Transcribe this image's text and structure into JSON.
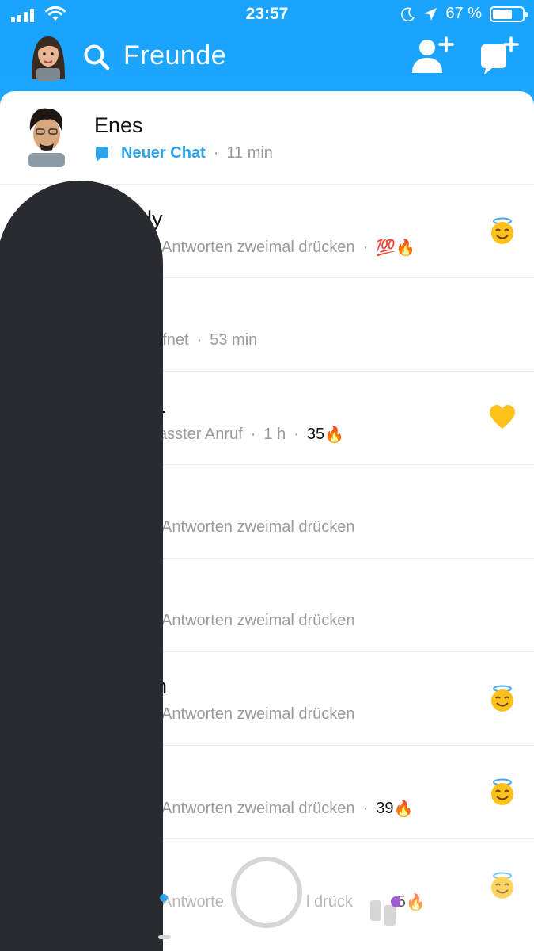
{
  "status_bar": {
    "time": "23:57",
    "battery_percent": "67 %",
    "battery_level": 0.67
  },
  "header": {
    "title": "Freunde"
  },
  "chats": [
    {
      "name": "Enes",
      "status": "Neuer Chat",
      "time": "11 min",
      "status_type": "new"
    },
    {
      "name": "dy",
      "status": "Antworten zweimal drücken",
      "streak_icon": "💯🔥",
      "badge": "halo-smile-emoji"
    },
    {
      "name": "",
      "status": "ffnet",
      "time": "53 min"
    },
    {
      "name": "k.",
      "status": "asster Anruf",
      "time": "1 h",
      "streak": "35",
      "badge": "yellow-heart-emoji"
    },
    {
      "name": "",
      "status": "Antworten zweimal drücken"
    },
    {
      "name": "",
      "status": "Antworten zweimal drücken"
    },
    {
      "name": "n",
      "status": "Antworten zweimal drücken",
      "badge": "halo-smile-emoji"
    },
    {
      "name": "",
      "status": "Antworten zweimal drücken",
      "streak": "39",
      "badge": "halo-smile-emoji"
    },
    {
      "name": "",
      "status": "Antworte",
      "status_tail": "l drück",
      "streak": "5",
      "badge": "halo-smile-emoji"
    }
  ],
  "colors": {
    "header_gradient_top": "#1aa3ff",
    "header_gradient_bottom": "#2cc0ff",
    "accent_blue": "#2ca4ec",
    "muted_text": "#9a9a9a",
    "redaction": "#282c30"
  }
}
